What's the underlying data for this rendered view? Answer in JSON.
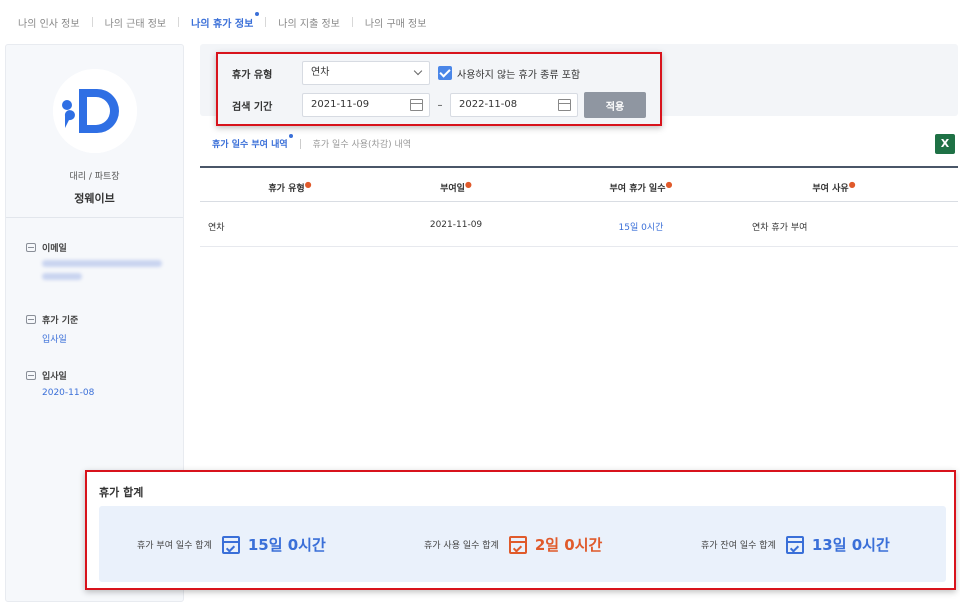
{
  "nav": {
    "tabs": [
      {
        "label": "나의 인사 정보"
      },
      {
        "label": "나의 근태 정보"
      },
      {
        "label": "나의 휴가 정보"
      },
      {
        "label": "나의 지출 정보"
      },
      {
        "label": "나의 구매 정보"
      }
    ],
    "active_index": 2
  },
  "profile": {
    "role": "대리 / 파트장",
    "name": "정웨이브",
    "email_label": "이메일",
    "leave_basis_label": "휴가 기준",
    "leave_basis_value": "입사일",
    "join_date_label": "입사일",
    "join_date_value": "2020-11-08"
  },
  "filter": {
    "type_label": "휴가 유형",
    "type_value": "연차",
    "include_unused_label": "사용하지 않는 휴가 종류 포함",
    "include_unused_checked": true,
    "period_label": "검색 기간",
    "start_date": "2021-11-09",
    "end_date": "2022-11-08",
    "dash": "–",
    "apply_label": "적용"
  },
  "subtabs": [
    {
      "label": "휴가 일수 부여 내역"
    },
    {
      "label": "휴가 일수 사용(차감) 내역"
    }
  ],
  "excel_icon": "excel-icon",
  "table": {
    "headers": [
      "휴가 유형",
      "부여일",
      "부여 휴가 일수",
      "부여 사유"
    ],
    "rows": [
      {
        "type": "연차",
        "date": "2021-11-09",
        "days": "15일 0시간",
        "reason": "연차 휴가 부여"
      }
    ]
  },
  "summary": {
    "title": "휴가 합계",
    "granted_label": "휴가 부여 일수 합계",
    "granted_value": "15일 0시간",
    "used_label": "휴가 사용 일수 합계",
    "used_value": "2일 0시간",
    "remaining_label": "휴가 잔여 일수 합계",
    "remaining_value": "13일 0시간"
  },
  "colors": {
    "accent": "#3a6fd8",
    "used": "#e05a2b",
    "highlight_border": "#d8131c"
  }
}
